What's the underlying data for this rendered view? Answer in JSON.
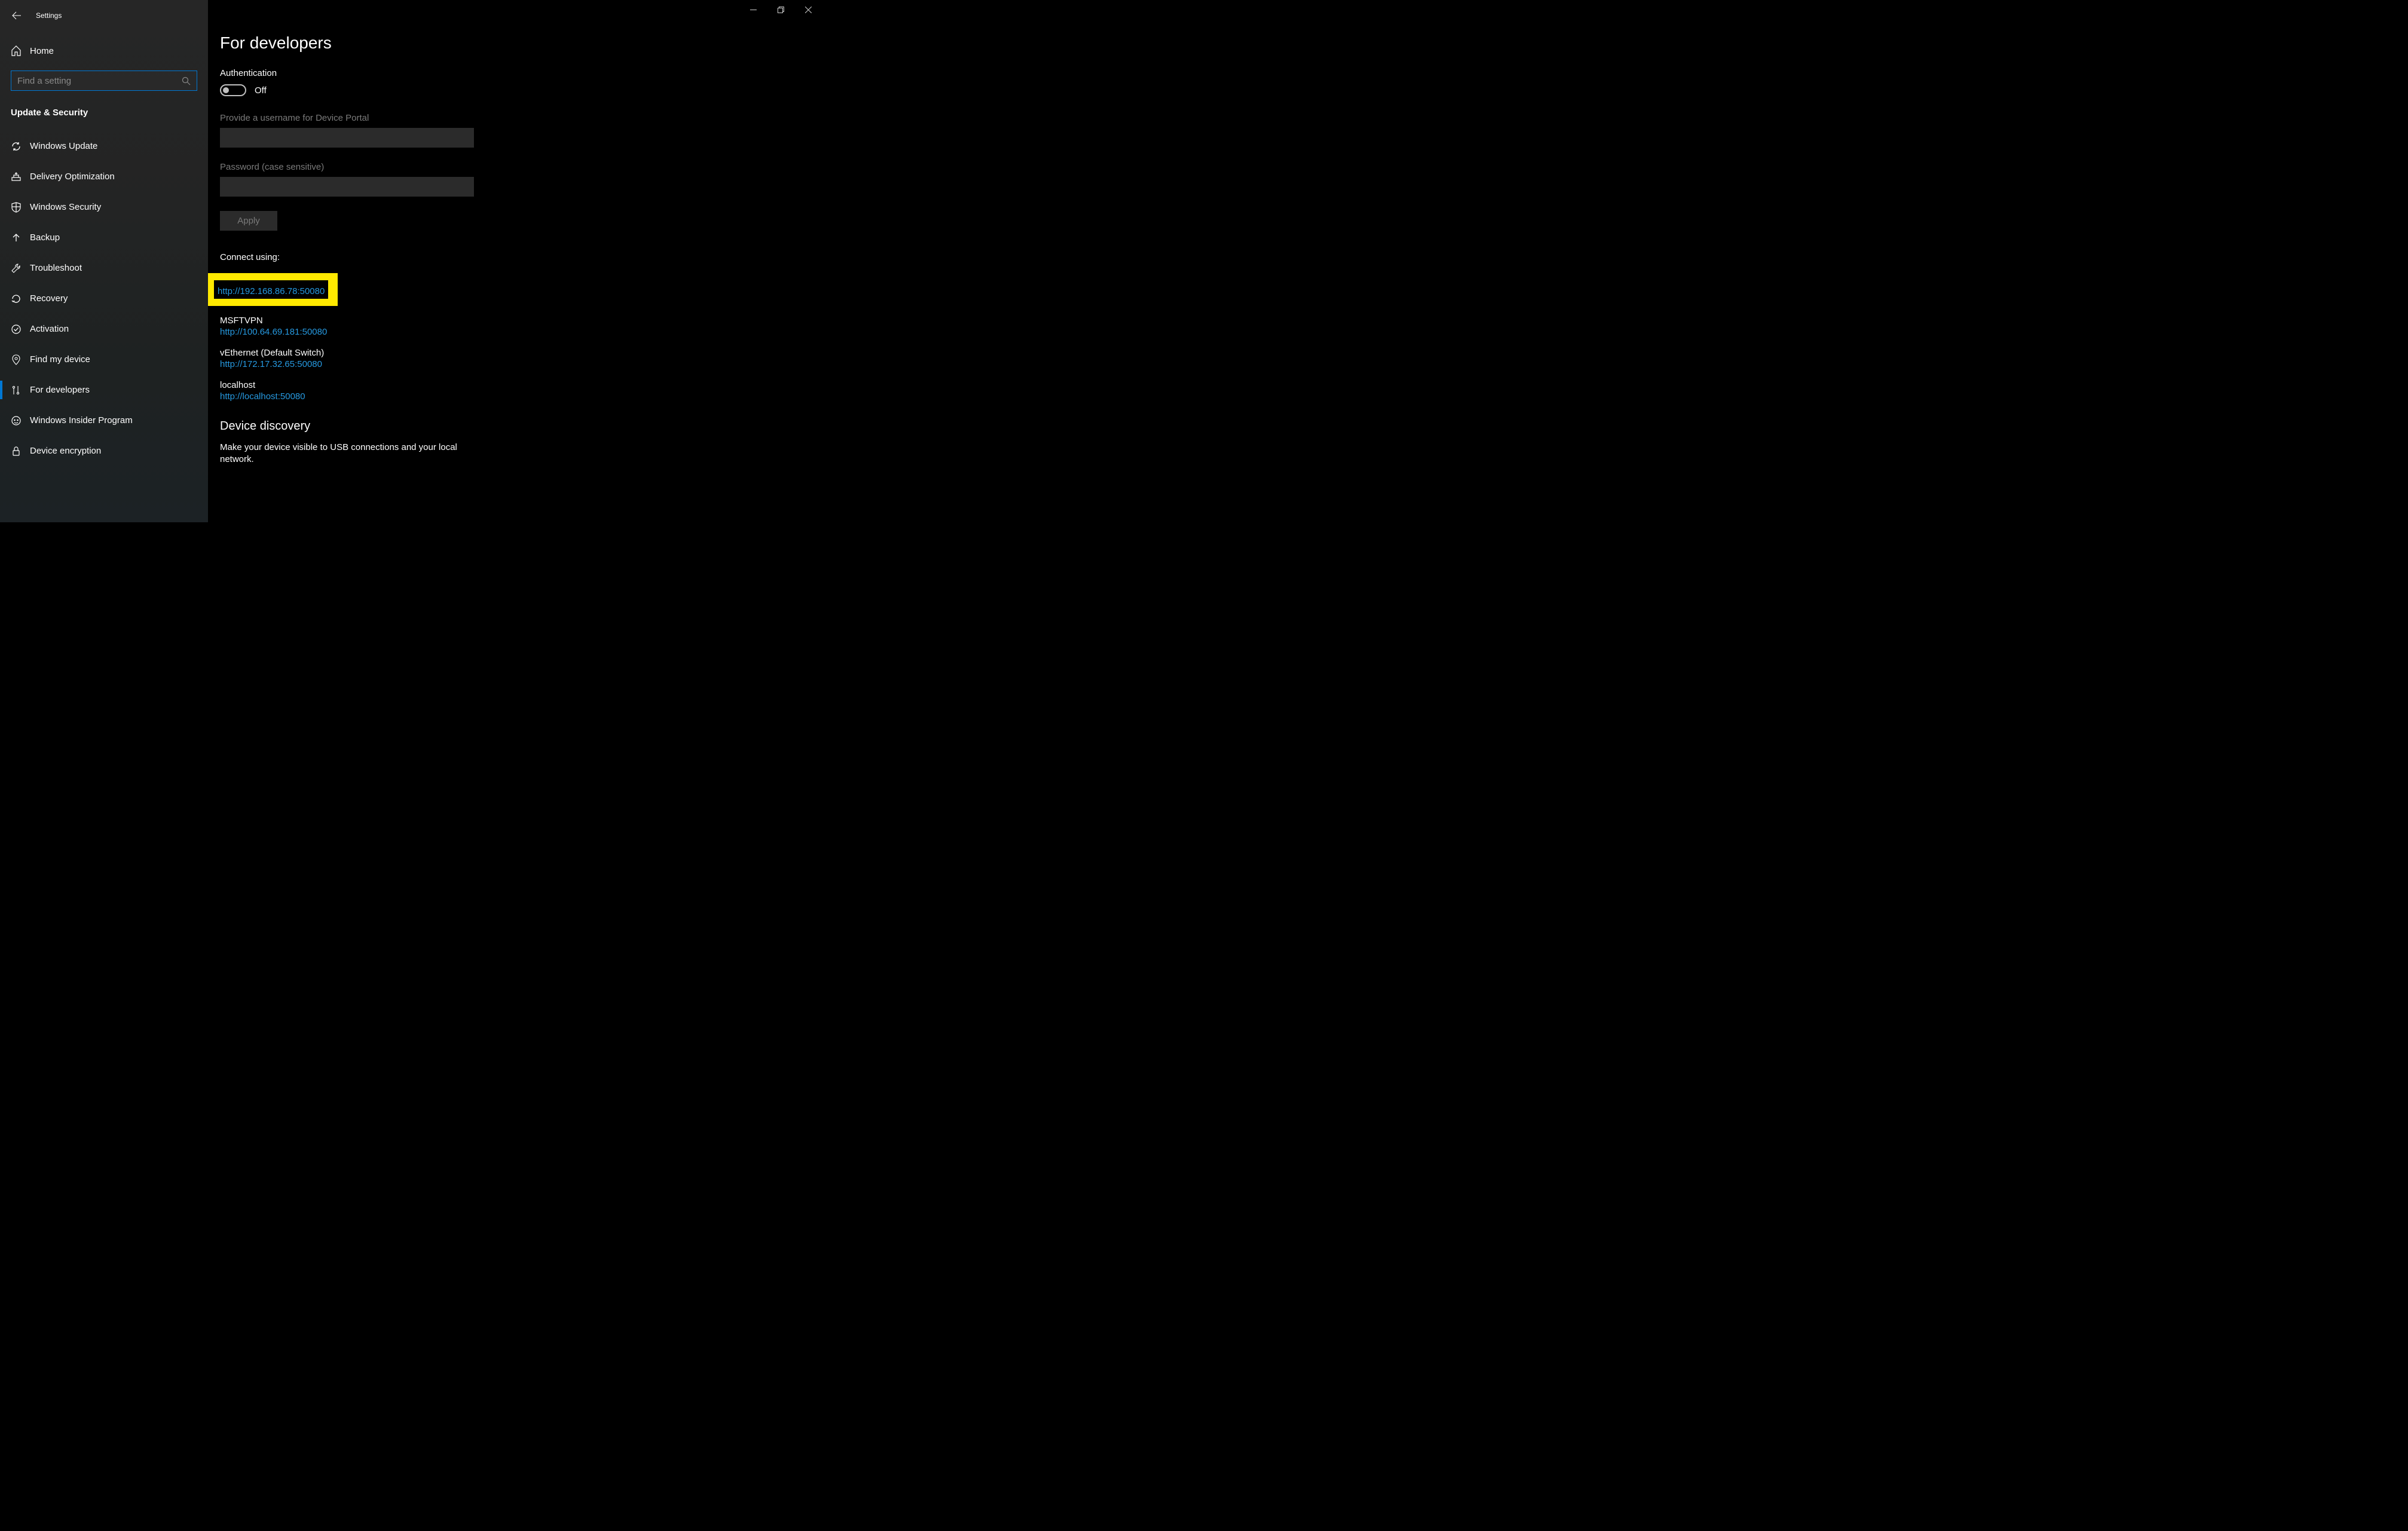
{
  "app_title": "Settings",
  "home_label": "Home",
  "search_placeholder": "Find a setting",
  "section_title": "Update & Security",
  "nav_items": [
    {
      "id": "windows-update",
      "label": "Windows Update"
    },
    {
      "id": "delivery-optimization",
      "label": "Delivery Optimization"
    },
    {
      "id": "windows-security",
      "label": "Windows Security"
    },
    {
      "id": "backup",
      "label": "Backup"
    },
    {
      "id": "troubleshoot",
      "label": "Troubleshoot"
    },
    {
      "id": "recovery",
      "label": "Recovery"
    },
    {
      "id": "activation",
      "label": "Activation"
    },
    {
      "id": "find-my-device",
      "label": "Find my device"
    },
    {
      "id": "for-developers",
      "label": "For developers"
    },
    {
      "id": "windows-insider",
      "label": "Windows Insider Program"
    },
    {
      "id": "device-encryption",
      "label": "Device encryption"
    }
  ],
  "active_nav_index": 8,
  "page_title": "For developers",
  "auth": {
    "heading": "Authentication",
    "toggle_state": "Off",
    "username_label": "Provide a username for Device Portal",
    "username_value": "",
    "password_label": "Password (case sensitive)",
    "password_value": "",
    "apply_label": "Apply"
  },
  "connect": {
    "label": "Connect using:",
    "highlighted": {
      "url": "http://192.168.86.78:50080"
    },
    "items": [
      {
        "name": "MSFTVPN",
        "url": "http://100.64.69.181:50080"
      },
      {
        "name": "vEthernet (Default Switch)",
        "url": "http://172.17.32.65:50080"
      },
      {
        "name": "localhost",
        "url": "http://localhost:50080"
      }
    ]
  },
  "discovery": {
    "heading": "Device discovery",
    "desc": "Make your device visible to USB connections and your local network."
  }
}
